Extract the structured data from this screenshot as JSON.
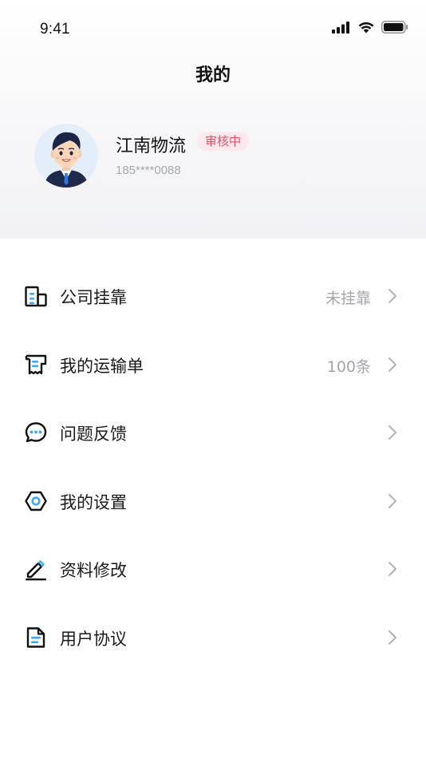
{
  "status_bar": {
    "time": "9:41"
  },
  "header": {
    "title": "我的"
  },
  "profile": {
    "name": "江南物流",
    "badge": "审核中",
    "phone": "185****0088"
  },
  "menu": [
    {
      "label": "公司挂靠",
      "value": "未挂靠",
      "icon": "building-icon"
    },
    {
      "label": "我的运输单",
      "value": "100条",
      "icon": "receipt-icon"
    },
    {
      "label": "问题反馈",
      "value": "",
      "icon": "chat-bubble-icon"
    },
    {
      "label": "我的设置",
      "value": "",
      "icon": "hexagon-settings-icon"
    },
    {
      "label": "资料修改",
      "value": "",
      "icon": "edit-pen-icon"
    },
    {
      "label": "用户协议",
      "value": "",
      "icon": "document-icon"
    }
  ],
  "colors": {
    "accent": "#3fa9f5",
    "badge_text": "#e8506a",
    "badge_bg": "#fde9ec",
    "muted_text": "#a3a5aa"
  }
}
